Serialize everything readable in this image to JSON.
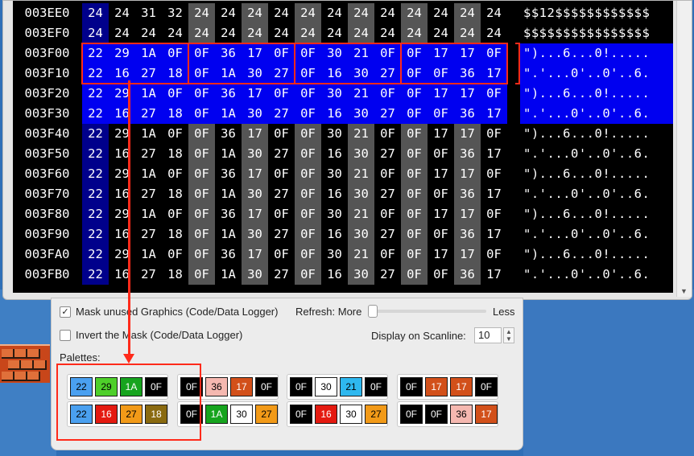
{
  "hex_view": {
    "rows": [
      {
        "address": "003EE0",
        "bytes": [
          "24",
          "24",
          "31",
          "32",
          "24",
          "24",
          "24",
          "24",
          "24",
          "24",
          "24",
          "24",
          "24",
          "24",
          "24",
          "24"
        ],
        "ascii": "$$12$$$$$$$$$$$$",
        "selected": false
      },
      {
        "address": "003EF0",
        "bytes": [
          "24",
          "24",
          "24",
          "24",
          "24",
          "24",
          "24",
          "24",
          "24",
          "24",
          "24",
          "24",
          "24",
          "24",
          "24",
          "24"
        ],
        "ascii": "$$$$$$$$$$$$$$$$",
        "selected": false
      },
      {
        "address": "003F00",
        "bytes": [
          "22",
          "29",
          "1A",
          "0F",
          "0F",
          "36",
          "17",
          "0F",
          "0F",
          "30",
          "21",
          "0F",
          "0F",
          "17",
          "17",
          "0F"
        ],
        "ascii": "\")...6...0!.....",
        "selected": true
      },
      {
        "address": "003F10",
        "bytes": [
          "22",
          "16",
          "27",
          "18",
          "0F",
          "1A",
          "30",
          "27",
          "0F",
          "16",
          "30",
          "27",
          "0F",
          "0F",
          "36",
          "17"
        ],
        "ascii": "\".'...0'..0'..6.",
        "selected": true
      },
      {
        "address": "003F20",
        "bytes": [
          "22",
          "29",
          "1A",
          "0F",
          "0F",
          "36",
          "17",
          "0F",
          "0F",
          "30",
          "21",
          "0F",
          "0F",
          "17",
          "17",
          "0F"
        ],
        "ascii": "\")...6...0!.....",
        "selected": true
      },
      {
        "address": "003F30",
        "bytes": [
          "22",
          "16",
          "27",
          "18",
          "0F",
          "1A",
          "30",
          "27",
          "0F",
          "16",
          "30",
          "27",
          "0F",
          "0F",
          "36",
          "17"
        ],
        "ascii": "\".'...0'..0'..6.",
        "selected": true
      },
      {
        "address": "003F40",
        "bytes": [
          "22",
          "29",
          "1A",
          "0F",
          "0F",
          "36",
          "17",
          "0F",
          "0F",
          "30",
          "21",
          "0F",
          "0F",
          "17",
          "17",
          "0F"
        ],
        "ascii": "\")...6...0!.....",
        "selected": false
      },
      {
        "address": "003F50",
        "bytes": [
          "22",
          "16",
          "27",
          "18",
          "0F",
          "1A",
          "30",
          "27",
          "0F",
          "16",
          "30",
          "27",
          "0F",
          "0F",
          "36",
          "17"
        ],
        "ascii": "\".'...0'..0'..6.",
        "selected": false
      },
      {
        "address": "003F60",
        "bytes": [
          "22",
          "29",
          "1A",
          "0F",
          "0F",
          "36",
          "17",
          "0F",
          "0F",
          "30",
          "21",
          "0F",
          "0F",
          "17",
          "17",
          "0F"
        ],
        "ascii": "\")...6...0!.....",
        "selected": false
      },
      {
        "address": "003F70",
        "bytes": [
          "22",
          "16",
          "27",
          "18",
          "0F",
          "1A",
          "30",
          "27",
          "0F",
          "16",
          "30",
          "27",
          "0F",
          "0F",
          "36",
          "17"
        ],
        "ascii": "\".'...0'..0'..6.",
        "selected": false
      },
      {
        "address": "003F80",
        "bytes": [
          "22",
          "29",
          "1A",
          "0F",
          "0F",
          "36",
          "17",
          "0F",
          "0F",
          "30",
          "21",
          "0F",
          "0F",
          "17",
          "17",
          "0F"
        ],
        "ascii": "\")...6...0!.....",
        "selected": false
      },
      {
        "address": "003F90",
        "bytes": [
          "22",
          "16",
          "27",
          "18",
          "0F",
          "1A",
          "30",
          "27",
          "0F",
          "16",
          "30",
          "27",
          "0F",
          "0F",
          "36",
          "17"
        ],
        "ascii": "\".'...0'..0'..6.",
        "selected": false
      },
      {
        "address": "003FA0",
        "bytes": [
          "22",
          "29",
          "1A",
          "0F",
          "0F",
          "36",
          "17",
          "0F",
          "0F",
          "30",
          "21",
          "0F",
          "0F",
          "17",
          "17",
          "0F"
        ],
        "ascii": "\")...6...0!.....",
        "selected": false
      },
      {
        "address": "003FB0",
        "bytes": [
          "22",
          "16",
          "27",
          "18",
          "0F",
          "1A",
          "30",
          "27",
          "0F",
          "16",
          "30",
          "27",
          "0F",
          "0F",
          "36",
          "17"
        ],
        "ascii": "\".'...0'..0'..6.",
        "selected": false
      }
    ],
    "column_shades": [
      "#00008b",
      "#000000",
      "#000000",
      "#000000",
      "#555555",
      "#000000",
      "#555555",
      "#000000",
      "#555555",
      "#000000",
      "#555555",
      "#000000",
      "#555555",
      "#000000",
      "#555555",
      "#000000"
    ],
    "selection_color": "#0000f0",
    "annotation_color": "#ff2a1a"
  },
  "panel": {
    "mask_unused_label": "Mask unused Graphics (Code/Data Logger)",
    "mask_unused_checked": true,
    "refresh_label": "Refresh: More",
    "refresh_less_label": "Less",
    "refresh_level": 0,
    "invert_mask_label": "Invert the Mask (Code/Data Logger)",
    "invert_mask_checked": false,
    "scanline_label": "Display on Scanline:",
    "scanline_value": "10",
    "palettes_label": "Palettes:",
    "palettes": [
      [
        {
          "v": "22",
          "bg": "#4aa0f0",
          "fg": "#000000"
        },
        {
          "v": "29",
          "bg": "#4ecf2a",
          "fg": "#000000"
        },
        {
          "v": "1A",
          "bg": "#16a41e",
          "fg": "#ffffff"
        },
        {
          "v": "0F",
          "bg": "#000000",
          "fg": "#ffffff"
        }
      ],
      [
        {
          "v": "0F",
          "bg": "#000000",
          "fg": "#ffffff"
        },
        {
          "v": "36",
          "bg": "#f5b8b0",
          "fg": "#000000"
        },
        {
          "v": "17",
          "bg": "#d2501a",
          "fg": "#ffffff"
        },
        {
          "v": "0F",
          "bg": "#000000",
          "fg": "#ffffff"
        }
      ],
      [
        {
          "v": "0F",
          "bg": "#000000",
          "fg": "#ffffff"
        },
        {
          "v": "30",
          "bg": "#ffffff",
          "fg": "#000000"
        },
        {
          "v": "21",
          "bg": "#2eb8ef",
          "fg": "#000000"
        },
        {
          "v": "0F",
          "bg": "#000000",
          "fg": "#ffffff"
        }
      ],
      [
        {
          "v": "0F",
          "bg": "#000000",
          "fg": "#ffffff"
        },
        {
          "v": "17",
          "bg": "#d2501a",
          "fg": "#ffffff"
        },
        {
          "v": "17",
          "bg": "#d2501a",
          "fg": "#ffffff"
        },
        {
          "v": "0F",
          "bg": "#000000",
          "fg": "#ffffff"
        }
      ],
      [
        {
          "v": "22",
          "bg": "#4aa0f0",
          "fg": "#000000"
        },
        {
          "v": "16",
          "bg": "#e41a10",
          "fg": "#ffffff"
        },
        {
          "v": "27",
          "bg": "#f29a18",
          "fg": "#000000"
        },
        {
          "v": "18",
          "bg": "#8a6a10",
          "fg": "#ffffff"
        }
      ],
      [
        {
          "v": "0F",
          "bg": "#000000",
          "fg": "#ffffff"
        },
        {
          "v": "1A",
          "bg": "#16a41e",
          "fg": "#ffffff"
        },
        {
          "v": "30",
          "bg": "#ffffff",
          "fg": "#000000"
        },
        {
          "v": "27",
          "bg": "#f29a18",
          "fg": "#000000"
        }
      ],
      [
        {
          "v": "0F",
          "bg": "#000000",
          "fg": "#ffffff"
        },
        {
          "v": "16",
          "bg": "#e41a10",
          "fg": "#ffffff"
        },
        {
          "v": "30",
          "bg": "#ffffff",
          "fg": "#000000"
        },
        {
          "v": "27",
          "bg": "#f29a18",
          "fg": "#000000"
        }
      ],
      [
        {
          "v": "0F",
          "bg": "#000000",
          "fg": "#ffffff"
        },
        {
          "v": "0F",
          "bg": "#000000",
          "fg": "#ffffff"
        },
        {
          "v": "36",
          "bg": "#f5b8b0",
          "fg": "#000000"
        },
        {
          "v": "17",
          "bg": "#d2501a",
          "fg": "#ffffff"
        }
      ]
    ]
  }
}
